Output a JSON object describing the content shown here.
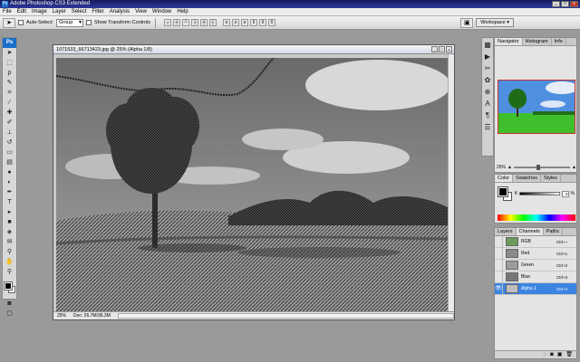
{
  "app": {
    "title": "Adobe Photoshop CS3 Extended",
    "ps_badge": "Ps"
  },
  "window_controls": {
    "minimize": "_",
    "maximize": "□",
    "close": "x"
  },
  "menu": [
    "File",
    "Edit",
    "Image",
    "Layer",
    "Select",
    "Filter",
    "Analysis",
    "View",
    "Window",
    "Help"
  ],
  "options": {
    "auto_select_label": "Auto-Select:",
    "auto_select_value": "Group",
    "show_transform_label": "Show Transform Controls",
    "workspace_label": "Workspace ▾"
  },
  "document": {
    "title": "1071533_66713423.jpg @ 25% (Alpha 1/8)",
    "zoom": "25%",
    "doc_info": "Doc: 26.7M/36.3M"
  },
  "navigator": {
    "tabs": [
      "Navigator",
      "Histogram",
      "Info"
    ],
    "zoom": "25%"
  },
  "color_panel": {
    "tabs": [
      "Color",
      "Swatches",
      "Styles"
    ],
    "channel_label": "K",
    "value": "0",
    "unit": "%"
  },
  "channels_panel": {
    "tabs": [
      "Layers",
      "Channels",
      "Paths"
    ],
    "rows": [
      {
        "name": "RGB",
        "shortcut": "Ctrl+~",
        "visible": false,
        "selected": false
      },
      {
        "name": "Red",
        "shortcut": "Ctrl+1",
        "visible": false,
        "selected": false
      },
      {
        "name": "Green",
        "shortcut": "Ctrl+2",
        "visible": false,
        "selected": false
      },
      {
        "name": "Blue",
        "shortcut": "Ctrl+3",
        "visible": false,
        "selected": false
      },
      {
        "name": "Alpha 1",
        "shortcut": "Ctrl+4",
        "visible": true,
        "selected": true
      }
    ]
  },
  "colors": {
    "title_bar": "#1e2a80",
    "selection_highlight": "#3c84e2",
    "ps_blue": "#1b6fc9"
  },
  "icons": {
    "eye": "👁"
  }
}
